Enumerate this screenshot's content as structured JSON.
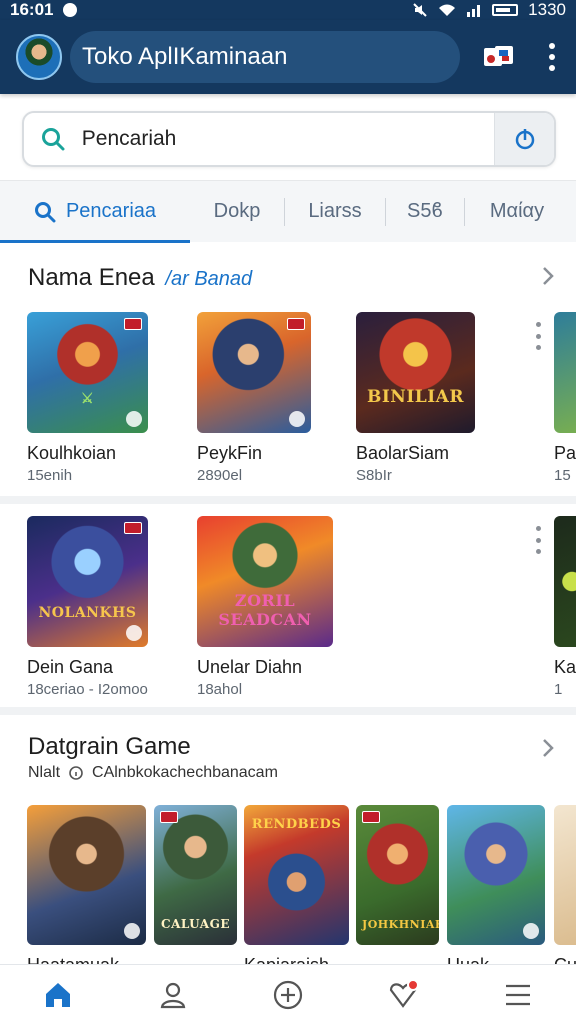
{
  "status_bar": {
    "time": "16:01",
    "battery_text": "1330"
  },
  "app_bar": {
    "title": "Toko AplIKaminaan",
    "avatar": "avatar",
    "action_icon": "flag-icon",
    "menu_icon": "more-vert-icon"
  },
  "search": {
    "placeholder": "Pencariah",
    "icon": "search-icon",
    "voice_icon": "voice-search-icon"
  },
  "tabs": [
    {
      "label": "Pencariaa",
      "active": true
    },
    {
      "label": "Dokp",
      "active": false
    },
    {
      "label": "Liarss",
      "active": false
    },
    {
      "label": "S5ϐ",
      "active": false
    },
    {
      "label": "Mαίαy",
      "active": false
    }
  ],
  "section1": {
    "title": "Nama Enea",
    "accent": "/ar Banad",
    "row1": [
      {
        "title": "Koulhkoian",
        "sub": "15enih"
      },
      {
        "title": "PeykFin",
        "sub": "2890el"
      },
      {
        "title": "BaolarSiam",
        "sub": "S8bIr",
        "logo": "BINILIAR"
      },
      {
        "title": "Pa",
        "sub": "15"
      }
    ],
    "row2": [
      {
        "title": "Dein Gana",
        "sub": "18ceriao - I2omoo",
        "logo": "NOLANKHS"
      },
      {
        "title": "Unelar Diahn",
        "sub": "18ahol",
        "logo": "ZORIL SEADCAN"
      },
      {
        "title": "Ka",
        "sub": "1"
      }
    ]
  },
  "section2": {
    "title": "Datgrain Game",
    "sub_left": "Nlalt",
    "sub_right": "CAlnbkokachechbanacam",
    "row": [
      {
        "title": "Haatamuak",
        "sub": ""
      },
      {
        "title": "",
        "sub": "",
        "logo": "CALUAGE"
      },
      {
        "title": "Kapiaraish",
        "sub": "",
        "logo": "RENDBEDS"
      },
      {
        "title": "",
        "sub": "",
        "logo": "JOHKHNIAK"
      },
      {
        "title": "Uuak",
        "sub": ""
      },
      {
        "title": "Cu",
        "sub": ""
      }
    ]
  },
  "bottom_nav": [
    {
      "icon": "home-icon",
      "active": true
    },
    {
      "icon": "profile-icon",
      "active": false
    },
    {
      "icon": "add-circle-icon",
      "active": false
    },
    {
      "icon": "favorites-icon",
      "active": false,
      "badge": true
    },
    {
      "icon": "menu-icon",
      "active": false
    }
  ],
  "colors": {
    "app_bar": "#14385f",
    "accent": "#1a73c9",
    "badge": "#e53935"
  }
}
